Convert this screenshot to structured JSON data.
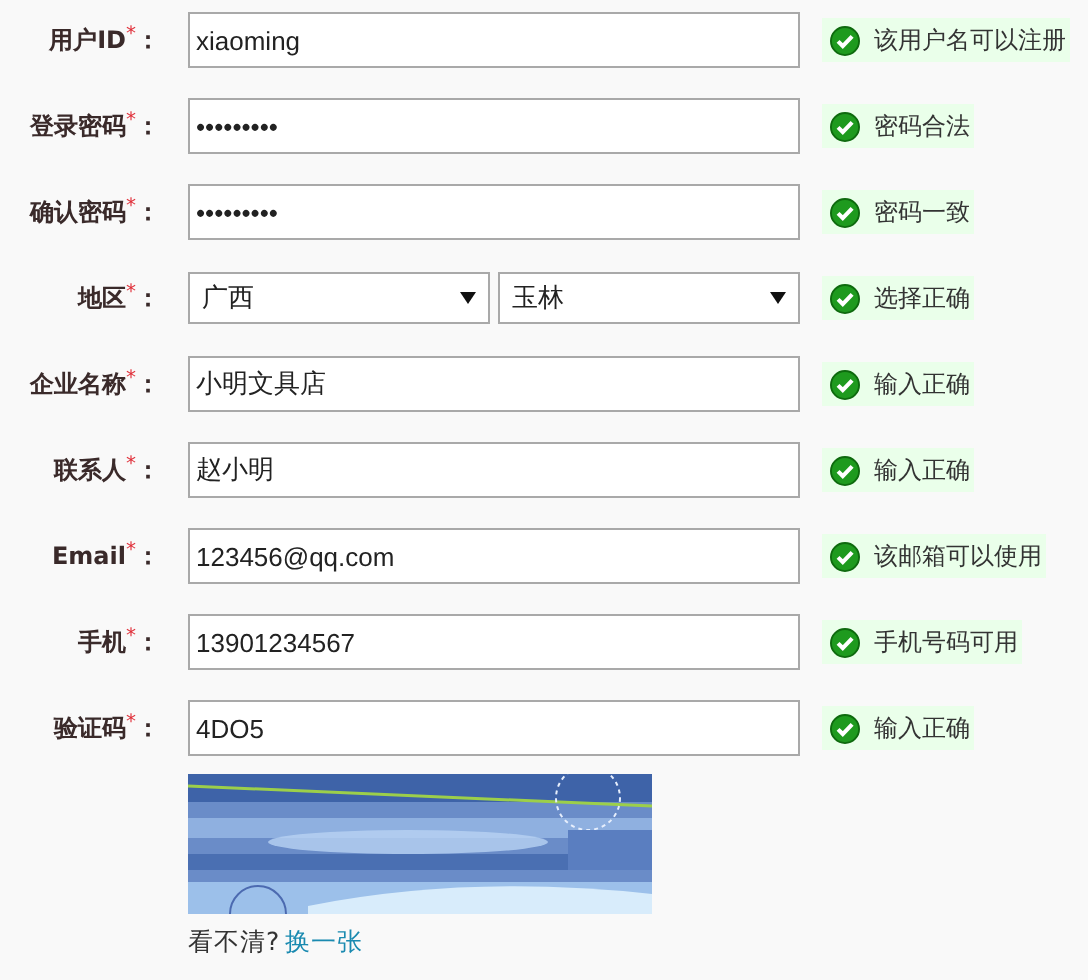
{
  "fields": [
    {
      "kind": "text",
      "label": "用户ID",
      "required_mark": "*",
      "colon": "：",
      "value": "xiaoming",
      "message": "该用户名可以注册",
      "valid": true
    },
    {
      "kind": "password",
      "label": "登录密码",
      "required_mark": "*",
      "colon": "：",
      "value": "•••••••••",
      "message": "密码合法",
      "valid": true
    },
    {
      "kind": "password",
      "label": "确认密码",
      "required_mark": "*",
      "colon": "：",
      "value": "•••••••••",
      "message": "密码一致",
      "valid": true
    },
    {
      "kind": "select-pair",
      "label": "地区",
      "required_mark": "*",
      "colon": "：",
      "values": [
        "广西",
        "玉林"
      ],
      "message": "选择正确",
      "valid": true
    },
    {
      "kind": "text",
      "label": "企业名称",
      "required_mark": "*",
      "colon": "：",
      "value": "小明文具店",
      "message": "输入正确",
      "valid": true
    },
    {
      "kind": "text",
      "label": "联系人",
      "required_mark": "*",
      "colon": "：",
      "value": "赵小明",
      "message": "输入正确",
      "valid": true
    },
    {
      "kind": "text",
      "label": "Email",
      "required_mark": "*",
      "colon": "：",
      "value": "123456@qq.com",
      "message": "该邮箱可以使用",
      "valid": true
    },
    {
      "kind": "text",
      "label": "手机",
      "required_mark": "*",
      "colon": "：",
      "value": "13901234567",
      "message": "手机号码可用",
      "valid": true
    },
    {
      "kind": "text",
      "label": "验证码",
      "required_mark": "*",
      "colon": "：",
      "value": "4DO5",
      "message": "输入正确",
      "valid": true
    }
  ],
  "captcha": {
    "kind": "picture",
    "hint": "看不清?",
    "refresh_link": "换一张"
  }
}
